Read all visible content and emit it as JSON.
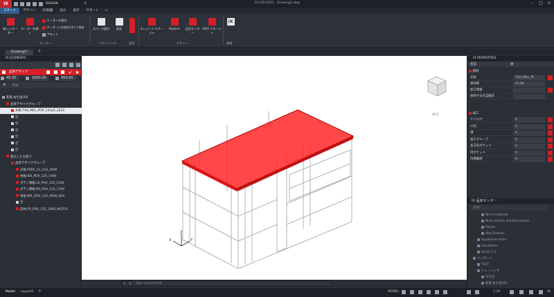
{
  "titlebar": {
    "logo": "IX",
    "workspace": "DESIGN",
    "layer_value": "0",
    "title": "iX CAD 2021 - Drawing1.dwg"
  },
  "menus": [
    "スタート",
    "デザイン",
    "2D製図",
    "出力",
    "表示",
    "サポート"
  ],
  "ribbon": {
    "buttons": [
      {
        "label": "新しいオーダー",
        "color": "#d61f26"
      },
      {
        "label": "オーダーを開く",
        "color": "#d61f26"
      },
      {
        "label": "オーダーの保存",
        "color": "#d61f26"
      },
      {
        "label": "オーダーに名前を付けて保存",
        "color": "#d61f26"
      },
      {
        "label": "プロット",
        "color": "#9aa3ad"
      },
      {
        "label": "スペース設計",
        "color": "#e6e6e6"
      },
      {
        "label": "設定",
        "color": "#e6e6e6"
      },
      {
        "label": "エレメントマネージャ",
        "color": "#d61f26"
      },
      {
        "label": "iXplorer",
        "color": "#d61f26"
      },
      {
        "label": "品目センター",
        "color": "#d61f26"
      },
      {
        "label": "VISU マネージャ",
        "color": "#d61f26"
      },
      {
        "label": "iX",
        "color": "#e6e6e6"
      }
    ],
    "groups": [
      "オーダー",
      "プランニング",
      "変数",
      "デザイン",
      "情報"
    ]
  },
  "doc_tab": "Drawing1*",
  "left_panel": {
    "title": "IX ELEMENTS",
    "header": "品目デザイナ",
    "dimensions": [
      "45.00",
      "1800.00",
      "450.00"
    ],
    "filter_placeholder": "検索",
    "tree": [
      {
        "label": "乾燥 右引出L60",
        "indent": 3,
        "color": "#9aa3ad",
        "selected": false
      },
      {
        "label": "品目デザイナグループ",
        "indent": 9,
        "color": "#d61f26",
        "selected": false
      },
      {
        "label": "天板:TSO_MEL_POV_131p5_2222",
        "indent": 16,
        "color": "#d61f26",
        "selected": true
      },
      {
        "label": "空",
        "indent": 16,
        "color": "#cfd3d8",
        "selected": false
      },
      {
        "label": "空",
        "indent": 16,
        "color": "#cfd3d8",
        "selected": false
      },
      {
        "label": "空",
        "indent": 16,
        "color": "#cfd3d8",
        "selected": false
      },
      {
        "label": "空",
        "indent": 16,
        "color": "#cfd3d8",
        "selected": false
      },
      {
        "label": "空",
        "indent": 16,
        "color": "#cfd3d8",
        "selected": false
      },
      {
        "label": "空",
        "indent": 16,
        "color": "#cfd3d8",
        "selected": false
      },
      {
        "label": "独立した分割:1",
        "indent": 9,
        "color": "#d61f26",
        "selected": false
      },
      {
        "label": "品目デザイナグループ",
        "indent": 16,
        "color": "#d61f26",
        "selected": false
      },
      {
        "label": "天板:FBRC_11_524_2000",
        "indent": 23,
        "color": "#d61f26",
        "selected": false
      },
      {
        "label": "地板:BSI_POV_125_1000",
        "indent": 23,
        "color": "#d61f26",
        "selected": false
      },
      {
        "label": "ボディ側板:LS_POV_125_1100",
        "indent": 23,
        "color": "#d61f26",
        "selected": false
      },
      {
        "label": "ボディ側板:RS_POV_125_1100",
        "indent": 23,
        "color": "#d61f26",
        "selected": false
      },
      {
        "label": "背板:BPL_POV_125_9000_850",
        "indent": 23,
        "color": "#d61f26",
        "selected": false
      },
      {
        "label": "空",
        "indent": 23,
        "color": "#cfd3d8",
        "selected": false
      },
      {
        "label": "前材:FR_POV_125_1000_NOTCH",
        "indent": 23,
        "color": "#d61f26",
        "selected": false
      }
    ]
  },
  "command": {
    "placeholder": "Type a command"
  },
  "right_panel": {
    "title": "IX PROPERTIES",
    "col_name": "名前",
    "col_value": "値",
    "section_material": "部材",
    "props": [
      {
        "name": "天板",
        "value": "TSO_MEL_PC",
        "red": true
      },
      {
        "name": "部材厚",
        "value": "21.00",
        "red": false
      },
      {
        "name": "加工情報",
        "value": "",
        "red": true
      },
      {
        "name": "部材寸法を自動計...",
        "value": "",
        "red": false
      }
    ],
    "section_process": "加工",
    "process_props": [
      {
        "name": "ドリル穴",
        "value": "0"
      },
      {
        "name": "穴列",
        "value": "0"
      },
      {
        "name": "溝",
        "value": "0"
      },
      {
        "name": "加工グループ",
        "value": "0"
      },
      {
        "name": "長方形ポケット",
        "value": "0"
      },
      {
        "name": "円ポケット",
        "value": "0"
      },
      {
        "name": "内側輪郭",
        "value": "0"
      }
    ],
    "center_title": "IX 品目センター",
    "center_search": "検索",
    "center_tree": [
      {
        "label": "Niche Cabinets",
        "indent": 20
      },
      {
        "label": "Niche Panels and Backsplash",
        "indent": 20
      },
      {
        "label": "Panels",
        "indent": 20
      },
      {
        "label": "Wall Shelves",
        "indent": 20
      },
      {
        "label": "Appliances Sinks",
        "indent": 14
      },
      {
        "label": "Handleless",
        "indent": 14
      },
      {
        "label": "Kosler 5.5",
        "indent": 14
      },
      {
        "label": "インポート",
        "indent": 8
      },
      {
        "label": "TEST",
        "indent": 14
      },
      {
        "label": "トレーニング",
        "indent": 14
      },
      {
        "label": "引き出",
        "indent": 20
      },
      {
        "label": "乾燥 右引出L60",
        "indent": 20
      }
    ]
  },
  "viewcube": {
    "label": "WCS"
  },
  "status": {
    "tabs": [
      "Model",
      "Layout1"
    ],
    "mode": "MODEL",
    "scale": "1:20"
  },
  "colors": {
    "accent": "#d61f26",
    "selection": "#ff0000"
  }
}
